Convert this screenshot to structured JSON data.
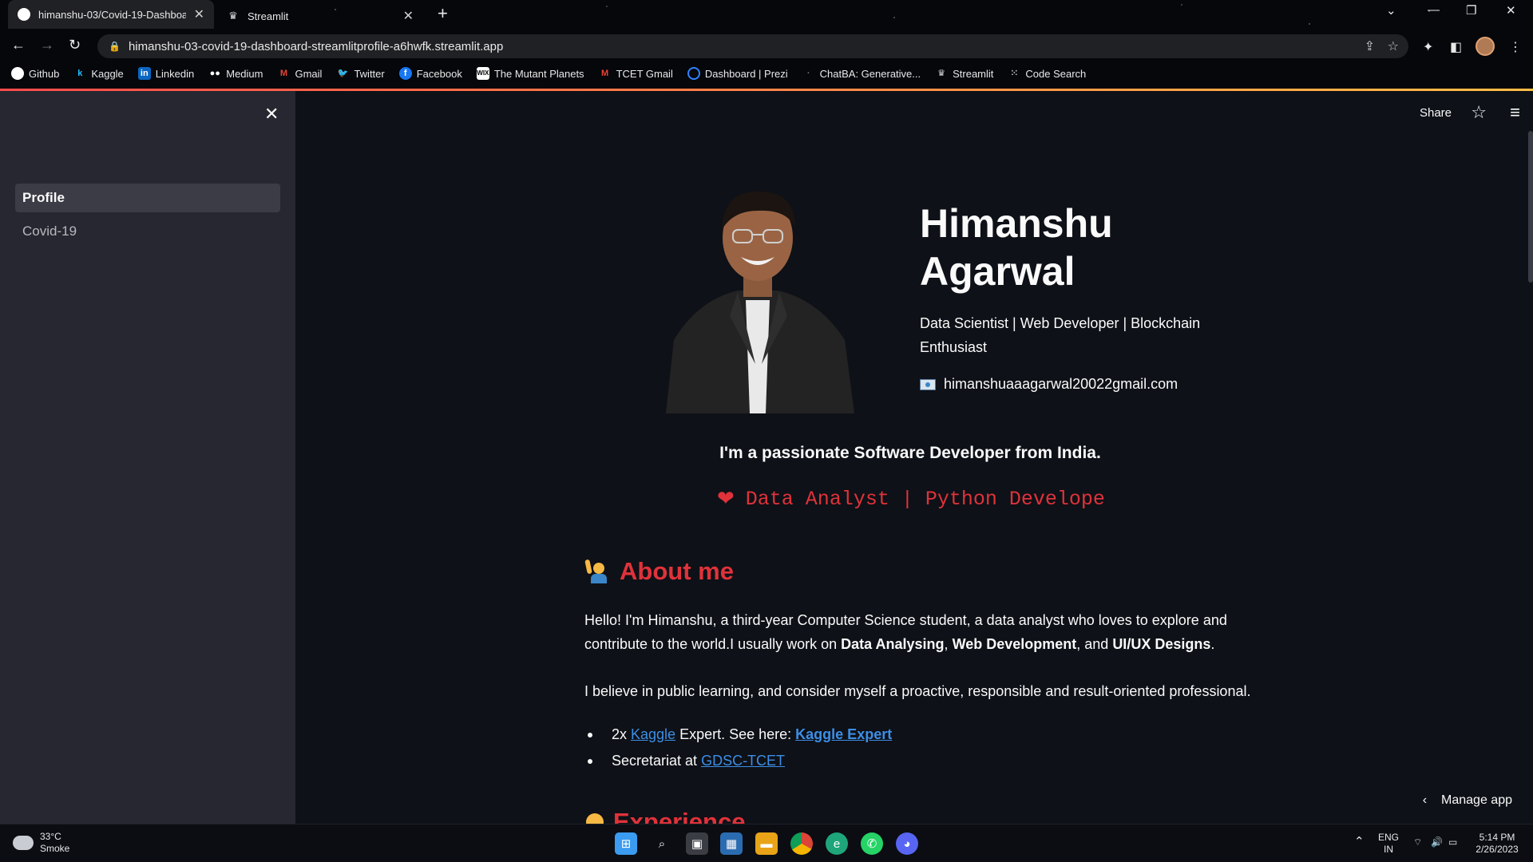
{
  "browser": {
    "tabs": [
      {
        "title": "himanshu-03/Covid-19-Dashboa",
        "icon": "github-icon",
        "active": true
      },
      {
        "title": "Streamlit",
        "icon": "streamlit-icon",
        "active": false
      }
    ],
    "new_tab": "+",
    "url": "himanshu-03-covid-19-dashboard-streamlitprofile-a6hwfk.streamlit.app",
    "bookmarks": [
      {
        "label": "Github",
        "icon": "github-icon"
      },
      {
        "label": "Kaggle",
        "icon": "kaggle-icon"
      },
      {
        "label": "Linkedin",
        "icon": "linkedin-icon"
      },
      {
        "label": "Medium",
        "icon": "medium-icon"
      },
      {
        "label": "Gmail",
        "icon": "gmail-icon"
      },
      {
        "label": "Twitter",
        "icon": "twitter-icon"
      },
      {
        "label": "Facebook",
        "icon": "facebook-icon"
      },
      {
        "label": "The Mutant Planets",
        "icon": "wix-icon"
      },
      {
        "label": "TCET Gmail",
        "icon": "gmail-icon"
      },
      {
        "label": "Dashboard | Prezi",
        "icon": "prezi-icon"
      },
      {
        "label": "ChatBA: Generative...",
        "icon": "chatba-icon"
      },
      {
        "label": "Streamlit",
        "icon": "streamlit-icon"
      },
      {
        "label": "Code Search",
        "icon": "code-search-icon"
      }
    ]
  },
  "sidebar": {
    "items": [
      {
        "label": "Profile",
        "active": true
      },
      {
        "label": "Covid-19",
        "active": false
      }
    ]
  },
  "topbar": {
    "share_label": "Share"
  },
  "profile": {
    "name": "Himanshu Agarwal",
    "tagline": "Data Scientist | Web Developer | Blockchain Enthusiast",
    "email": "himanshuaaagarwal20022gmail.com",
    "intro": "I'm a passionate Software Developer from India.",
    "typing_text": "Data Analyst | Python Develope"
  },
  "about": {
    "heading": "About me",
    "para1_pre": "Hello! I'm Himanshu, a third-year Computer Science student, a data analyst who loves to explore and contribute to the world.I usually work on ",
    "para1_b1": "Data Analysing",
    "para1_sep1": ", ",
    "para1_b2": "Web Development",
    "para1_sep2": ", and ",
    "para1_b3": "UI/UX Designs",
    "para1_end": ".",
    "para2": "I believe in public learning, and consider myself a proactive, responsible and result-oriented professional.",
    "bullet1_pre": "2x ",
    "bullet1_link1": "Kaggle",
    "bullet1_mid": " Expert. See here: ",
    "bullet1_link2": "Kaggle Expert",
    "bullet2_pre": "Secretariat at ",
    "bullet2_link": "GDSC-TCET"
  },
  "experience": {
    "heading": "Experience"
  },
  "manage_app": "Manage app",
  "taskbar": {
    "weather_temp": "33°C",
    "weather_desc": "Smoke",
    "lang1": "ENG",
    "lang2": "IN",
    "time": "5:14 PM",
    "date": "2/26/2023"
  },
  "colors": {
    "accent": "#ff4b4b",
    "heading_red": "#e0323a",
    "link": "#3d8ee6",
    "sidebar_bg": "#262730",
    "main_bg": "#0e1117"
  }
}
